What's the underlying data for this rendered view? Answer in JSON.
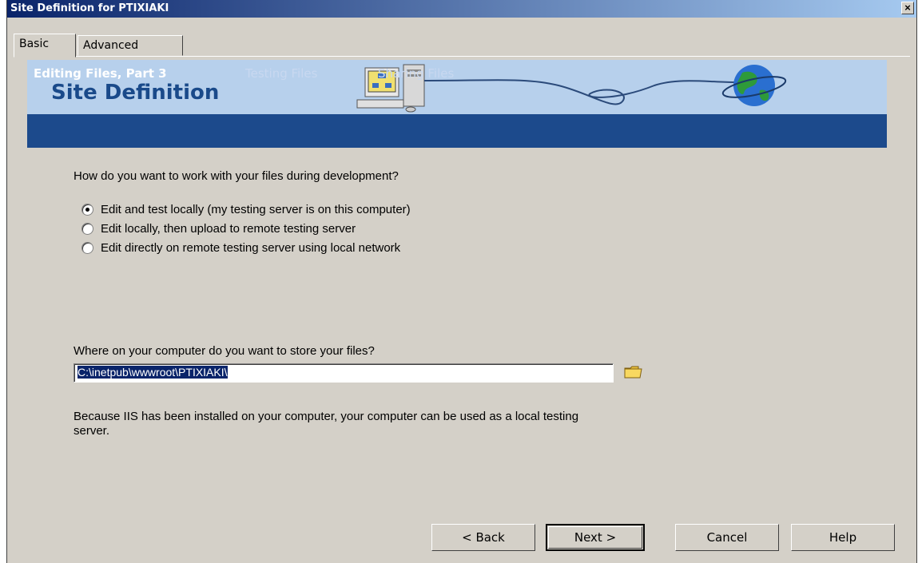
{
  "window": {
    "title": "Site Definition for PTIXIAKI",
    "close_label": "×"
  },
  "tabs": [
    {
      "label": "Basic"
    },
    {
      "label": "Advanced"
    }
  ],
  "banner": {
    "title": "Site Definition",
    "steps": [
      {
        "label": "Editing Files, Part 3"
      },
      {
        "label": "Testing Files"
      },
      {
        "label": "Sharing Files"
      }
    ]
  },
  "question1": "How do you want to work with your files during development?",
  "options": [
    {
      "label": "Edit and test locally (my testing server is on this computer)",
      "checked": true
    },
    {
      "label": "Edit locally, then upload to remote testing server",
      "checked": false
    },
    {
      "label": "Edit directly on remote testing server using local network",
      "checked": false
    }
  ],
  "question2": "Where on your computer do you want to store your files?",
  "path_value": "C:\\inetpub\\wwwroot\\PTIXIAKI\\",
  "info_line1": "Because IIS has been installed on your computer, your computer can be used as a local testing",
  "info_line2": "server.",
  "buttons": {
    "back": "< Back",
    "next": "Next >",
    "cancel": "Cancel",
    "help": "Help"
  }
}
